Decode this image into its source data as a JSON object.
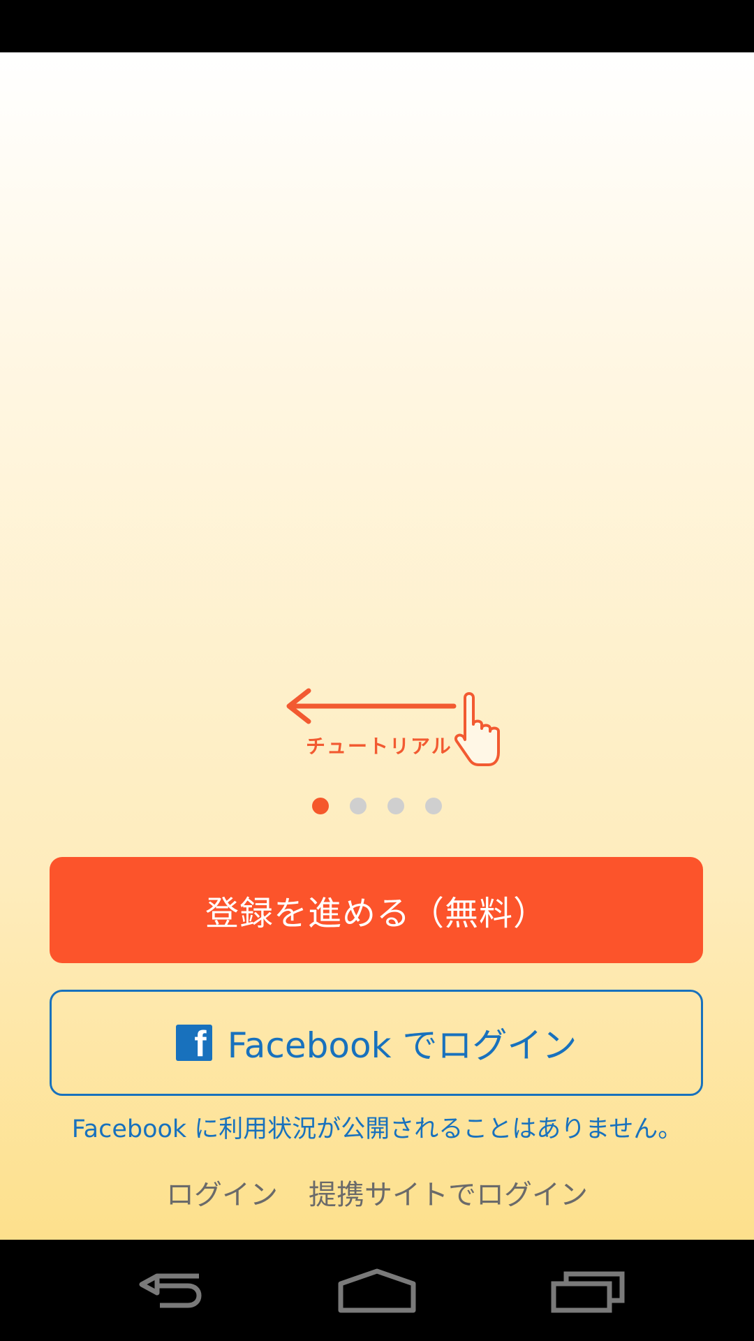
{
  "tutorial": {
    "label": "チュートリアル",
    "accent_color": "#f25a31"
  },
  "pager": {
    "total": 4,
    "active_index": 0
  },
  "actions": {
    "register_label": "登録を進める（無料）",
    "facebook_label": "Facebook でログイン",
    "facebook_icon": "f",
    "facebook_note": "Facebook に利用状況が公開されることはありません。",
    "login_link": "ログイン",
    "partner_login_link": "提携サイトでログイン"
  },
  "colors": {
    "primary": "#fc542b",
    "facebook": "#1871bd",
    "link_gray": "#6a6a6a"
  },
  "nav": {
    "back_icon": "back-icon",
    "home_icon": "home-icon",
    "recents_icon": "recents-icon"
  }
}
